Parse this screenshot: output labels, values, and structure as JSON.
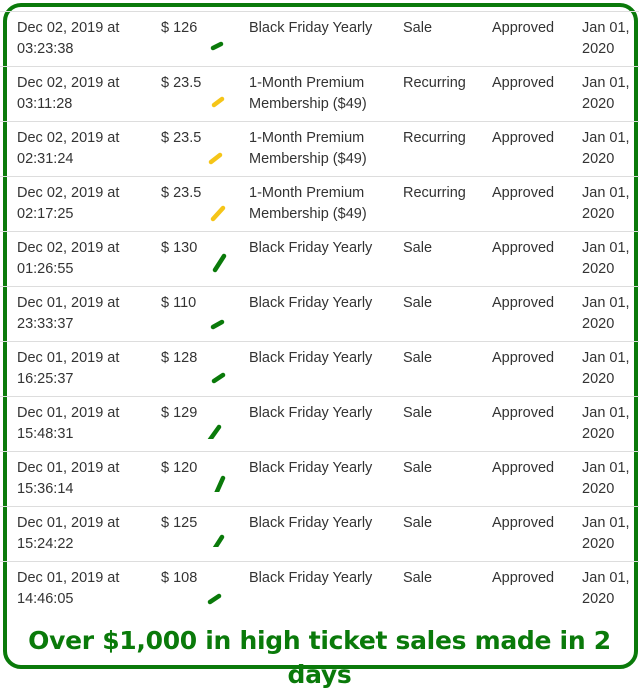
{
  "colors": {
    "frame": "#0a7a0a",
    "text": "#333333",
    "mark_sale": "#0a7a0a",
    "mark_recurring": "#f5c518",
    "footer": "#0a7a0a"
  },
  "rows": [
    {
      "date": "Dec 02, 2019 at",
      "time": "03:23:38",
      "amount": "$ 126",
      "mark": "green-check-mark",
      "product_line1": "Black Friday Yearly",
      "product_line2": "",
      "type": "Sale",
      "status": "Approved",
      "paid_line1": "Jan 01,",
      "paid_line2": "2020"
    },
    {
      "date": "Dec 02, 2019 at",
      "time": "03:11:28",
      "amount": "$ 23.5",
      "mark": "yellow-check-mark",
      "product_line1": "1-Month Premium",
      "product_line2": "Membership ($49)",
      "type": "Recurring",
      "status": "Approved",
      "paid_line1": "Jan 01,",
      "paid_line2": "2020"
    },
    {
      "date": "Dec 02, 2019 at",
      "time": "02:31:24",
      "amount": "$ 23.5",
      "mark": "yellow-check-mark",
      "product_line1": "1-Month Premium",
      "product_line2": "Membership ($49)",
      "type": "Recurring",
      "status": "Approved",
      "paid_line1": "Jan 01,",
      "paid_line2": "2020"
    },
    {
      "date": "Dec 02, 2019 at",
      "time": "02:17:25",
      "amount": "$ 23.5",
      "mark": "yellow-check-mark",
      "product_line1": "1-Month Premium",
      "product_line2": "Membership ($49)",
      "type": "Recurring",
      "status": "Approved",
      "paid_line1": "Jan 01,",
      "paid_line2": "2020"
    },
    {
      "date": "Dec 02, 2019 at",
      "time": "01:26:55",
      "amount": "$ 130",
      "mark": "green-check-mark",
      "product_line1": "Black Friday Yearly",
      "product_line2": "",
      "type": "Sale",
      "status": "Approved",
      "paid_line1": "Jan 01,",
      "paid_line2": "2020"
    },
    {
      "date": "Dec 01, 2019 at",
      "time": "23:33:37",
      "amount": "$ 110",
      "mark": "green-check-mark",
      "product_line1": "Black Friday Yearly",
      "product_line2": "",
      "type": "Sale",
      "status": "Approved",
      "paid_line1": "Jan 01,",
      "paid_line2": "2020"
    },
    {
      "date": "Dec 01, 2019 at",
      "time": "16:25:37",
      "amount": "$ 128",
      "mark": "green-check-mark",
      "product_line1": "Black Friday Yearly",
      "product_line2": "",
      "type": "Sale",
      "status": "Approved",
      "paid_line1": "Jan 01,",
      "paid_line2": "2020"
    },
    {
      "date": "Dec 01, 2019 at",
      "time": "15:48:31",
      "amount": "$ 129",
      "mark": "green-check-mark",
      "product_line1": "Black Friday Yearly",
      "product_line2": "",
      "type": "Sale",
      "status": "Approved",
      "paid_line1": "Jan 01,",
      "paid_line2": "2020"
    },
    {
      "date": "Dec 01, 2019 at",
      "time": "15:36:14",
      "amount": "$ 120",
      "mark": "green-check-mark",
      "product_line1": "Black Friday Yearly",
      "product_line2": "",
      "type": "Sale",
      "status": "Approved",
      "paid_line1": "Jan 01,",
      "paid_line2": "2020"
    },
    {
      "date": "Dec 01, 2019 at",
      "time": "15:24:22",
      "amount": "$ 125",
      "mark": "green-check-mark",
      "product_line1": "Black Friday Yearly",
      "product_line2": "",
      "type": "Sale",
      "status": "Approved",
      "paid_line1": "Jan 01,",
      "paid_line2": "2020"
    },
    {
      "date": "Dec 01, 2019 at",
      "time": "14:46:05",
      "amount": "$ 108",
      "mark": "green-check-mark",
      "product_line1": "Black Friday Yearly",
      "product_line2": "",
      "type": "Sale",
      "status": "Approved",
      "paid_line1": "Jan 01,",
      "paid_line2": "2020"
    }
  ],
  "footer": {
    "caption": "Over $1,000 in high ticket sales made in 2 days"
  }
}
